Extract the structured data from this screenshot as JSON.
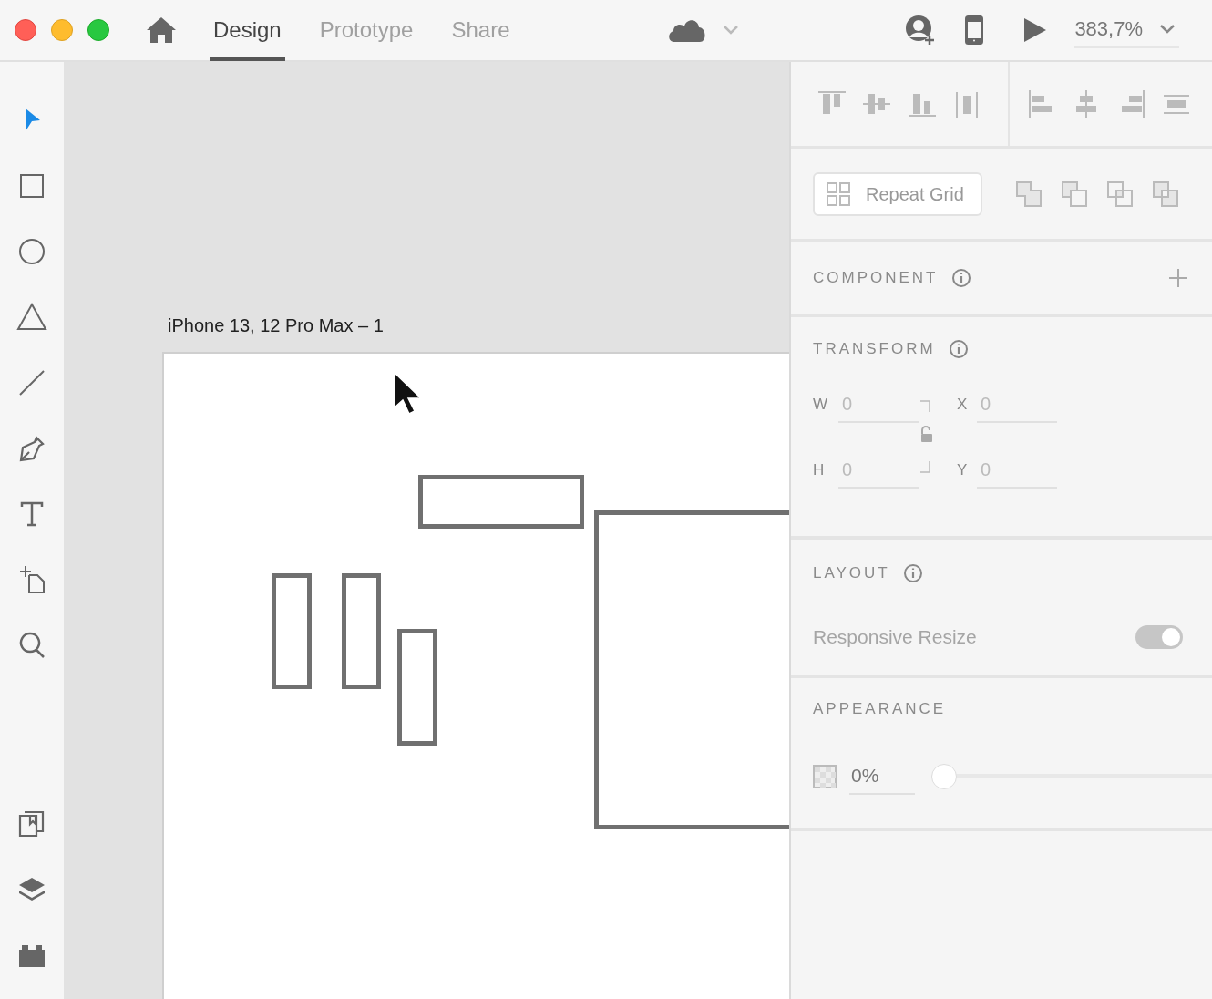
{
  "tabs": [
    {
      "label": "Design",
      "selected": true
    },
    {
      "label": "Prototype",
      "selected": false
    },
    {
      "label": "Share",
      "selected": false
    }
  ],
  "zoom": {
    "value": "383,7%"
  },
  "tools": [
    {
      "kind": "select",
      "selected": true
    },
    {
      "kind": "rectangle",
      "selected": false
    },
    {
      "kind": "ellipse",
      "selected": false
    },
    {
      "kind": "polygon",
      "selected": false
    },
    {
      "kind": "line",
      "selected": false
    },
    {
      "kind": "pen",
      "selected": false
    },
    {
      "kind": "text",
      "selected": false
    },
    {
      "kind": "artboard",
      "selected": false
    },
    {
      "kind": "zoom",
      "selected": false
    }
  ],
  "bottom_tools": [
    {
      "kind": "assets",
      "selected": false
    },
    {
      "kind": "layers",
      "selected": false
    },
    {
      "kind": "plugins",
      "selected": false
    }
  ],
  "canvas": {
    "artboard_title": "iPhone 13, 12 Pro Max – 1"
  },
  "panel": {
    "repeat_grid": {
      "label": "Repeat Grid"
    },
    "component": {
      "title": "COMPONENT"
    },
    "transform": {
      "title": "TRANSFORM",
      "fields": [
        {
          "label": "W",
          "placeholder": "0"
        },
        {
          "label": "X",
          "placeholder": "0"
        },
        {
          "label": "H",
          "placeholder": "0"
        },
        {
          "label": "Y",
          "placeholder": "0"
        }
      ]
    },
    "layout": {
      "title": "LAYOUT",
      "responsive_resize": {
        "label": "Responsive Resize",
        "on": true,
        "disabled": true
      }
    },
    "appearance": {
      "title": "APPEARANCE",
      "opacity": {
        "value": "0%",
        "level": 0
      }
    }
  }
}
